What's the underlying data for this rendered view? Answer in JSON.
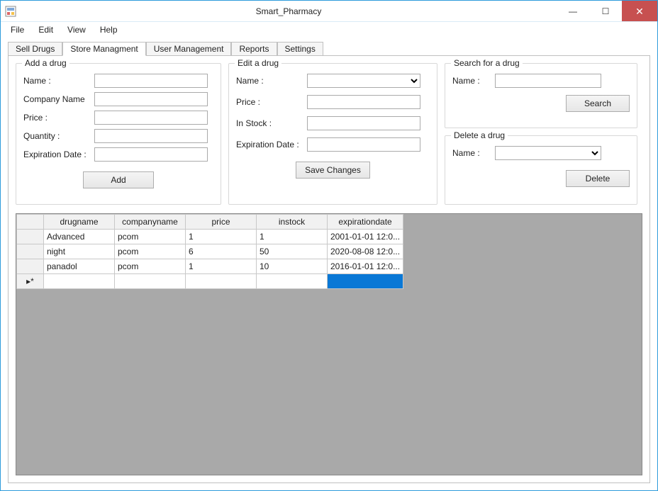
{
  "window": {
    "title": "Smart_Pharmacy"
  },
  "menu": {
    "file": "File",
    "edit": "Edit",
    "view": "View",
    "help": "Help"
  },
  "tabs": {
    "sell": "Sell Drugs",
    "store": "Store Managment",
    "user": "User Management",
    "reports": "Reports",
    "settings": "Settings"
  },
  "groupbox": {
    "add": {
      "legend": "Add a drug",
      "name_label": "Name :",
      "company_label": "Company Name",
      "price_label": "Price :",
      "quantity_label": "Quantity :",
      "expiration_label": "Expiration Date :",
      "button": "Add"
    },
    "edit": {
      "legend": "Edit a drug",
      "name_label": "Name :",
      "price_label": "Price :",
      "instock_label": "In Stock :",
      "expiration_label": "Expiration Date :",
      "button": "Save Changes"
    },
    "search": {
      "legend": "Search for a drug",
      "name_label": "Name :",
      "button": "Search"
    },
    "delete": {
      "legend": "Delete a drug",
      "name_label": "Name :",
      "button": "Delete"
    }
  },
  "grid": {
    "headers": {
      "drugname": "drugname",
      "companyname": "companyname",
      "price": "price",
      "instock": "instock",
      "expirationdate": "expirationdate"
    },
    "rows": [
      {
        "drugname": "Advanced",
        "companyname": "pcom",
        "price": "1",
        "instock": "1",
        "expirationdate": "2001-01-01 12:0..."
      },
      {
        "drugname": "night",
        "companyname": "pcom",
        "price": "6",
        "instock": "50",
        "expirationdate": "2020-08-08 12:0..."
      },
      {
        "drugname": "panadol",
        "companyname": "pcom",
        "price": "1",
        "instock": "10",
        "expirationdate": "2016-01-01 12:0..."
      }
    ],
    "newrow_indicator": "▸*"
  }
}
